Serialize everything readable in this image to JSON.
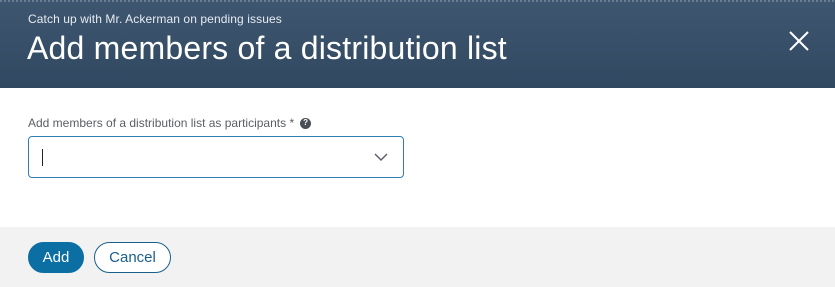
{
  "header": {
    "subtitle": "Catch up with Mr. Ackerman on pending issues",
    "title": "Add members of a distribution list",
    "close_icon": "close-icon"
  },
  "form": {
    "field_label": "Add members of a distribution list as participants *",
    "help_icon": "help-icon",
    "help_glyph": "?",
    "select_value": "",
    "dropdown_icon": "chevron-down-icon"
  },
  "footer": {
    "add_label": "Add",
    "cancel_label": "Cancel"
  },
  "colors": {
    "header_bg": "#3a5069",
    "accent": "#0b6fa4",
    "input_border": "#2f7fb5",
    "footer_bg": "#f2f2f2"
  }
}
